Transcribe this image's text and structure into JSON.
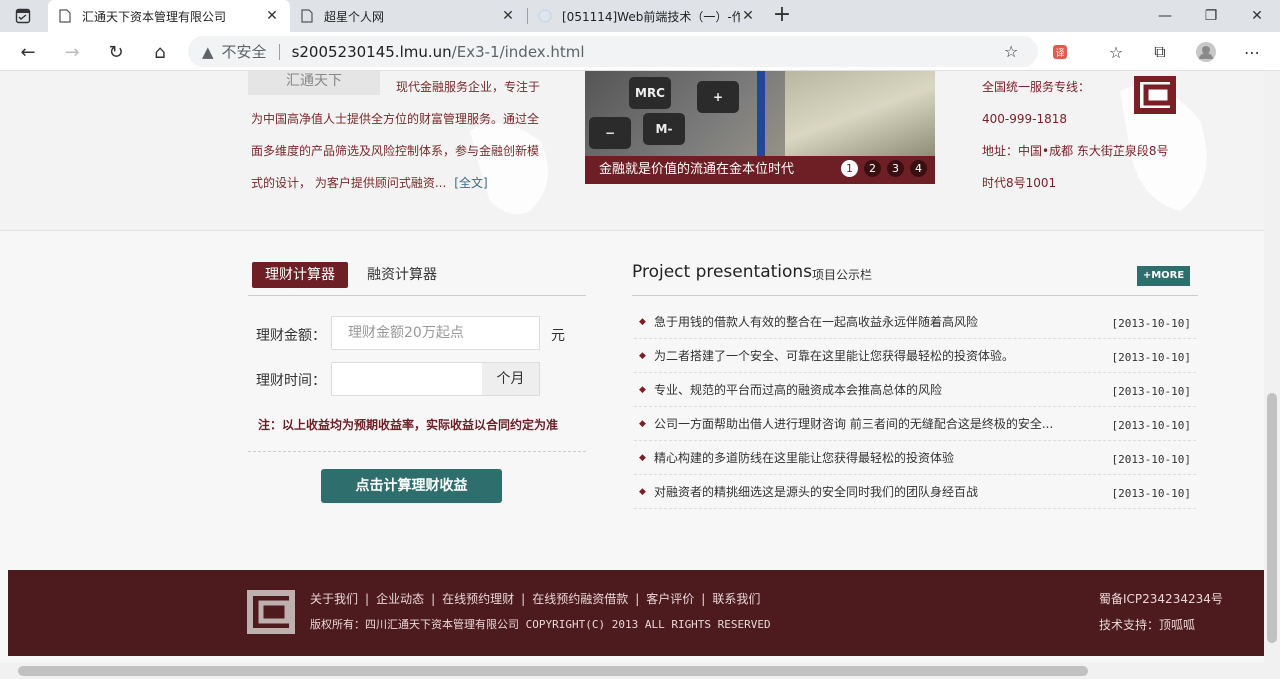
{
  "browser": {
    "tabs": [
      {
        "title": "汇通天下资本管理有限公司",
        "active": true
      },
      {
        "title": "超星个人网",
        "active": false
      },
      {
        "title": "[051114]Web前端技术（一）-作",
        "active": false
      }
    ],
    "address": {
      "insecure_label": "不安全",
      "host": "s2005230145.lmu.un",
      "path": "/Ex3-1/index.html"
    }
  },
  "intro": {
    "logo_text": "汇通天下",
    "lines": [
      "现代金融服务企业，专注于",
      "为中国高净值人士提供全方位的财富管理服务。通过全",
      "面多维度的产品筛选及风险控制体系，参与金融创新模",
      "式的设计， 为客户提供顾问式融资..."
    ],
    "more": "[全文]"
  },
  "banner": {
    "caption": "金融就是价值的流通在金本位时代",
    "dots": [
      "1",
      "2",
      "3",
      "4"
    ],
    "active_dot": 1,
    "keys": [
      "MRC",
      "M-",
      "−",
      "+"
    ]
  },
  "contact": {
    "hotline_label": "全国统一服务专线：",
    "phone": "400-999-1818",
    "address_line1": "地址：中国•成都 东大街芷泉段8号",
    "address_line2": "时代8号1001"
  },
  "calculator": {
    "tab_active": "理财计算器",
    "tab_inactive": "融资计算器",
    "amount_label": "理财金额：",
    "amount_placeholder": "理财金额20万起点",
    "amount_unit": "元",
    "time_label": "理财时间：",
    "time_unit": "个月",
    "note": "注：以上收益均为预期收益率，实际收益以合同约定为准",
    "button": "点击计算理财收益"
  },
  "projects": {
    "title": "Project presentations",
    "subtitle": "项目公示栏",
    "more": "+MORE",
    "items": [
      {
        "text": "急于用钱的借款人有效的整合在一起高收益永远伴随着高风险",
        "date": "[2013-10-10]"
      },
      {
        "text": "为二者搭建了一个安全、可靠在这里能让您获得最轻松的投资体验。",
        "date": "[2013-10-10]"
      },
      {
        "text": "专业、规范的平台而过高的融资成本会推高总体的风险",
        "date": "[2013-10-10]"
      },
      {
        "text": "公司一方面帮助出借人进行理财咨询 前三者间的无缝配合这是终极的安全...",
        "date": "[2013-10-10]"
      },
      {
        "text": "精心构建的多道防线在这里能让您获得最轻松的投资体验",
        "date": "[2013-10-10]"
      },
      {
        "text": "对融资者的精挑细选这是源头的安全同时我们的团队身经百战",
        "date": "[2013-10-10]"
      }
    ]
  },
  "footer": {
    "links": [
      "关于我们",
      "企业动态",
      "在线预约理财",
      "在线预约融资借款",
      "客户评价",
      "联系我们"
    ],
    "copyright": "版权所有：四川汇通天下资本管理有限公司 COPYRIGHT(C) 2013 ALL RIGHTS RESERVED",
    "icp": "蜀备ICP234234234号",
    "tech": "技术支持：顶呱呱"
  },
  "colors": {
    "brand": "#6d1f25",
    "accent": "#2e6e6d",
    "footer": "#4d1a1e"
  }
}
